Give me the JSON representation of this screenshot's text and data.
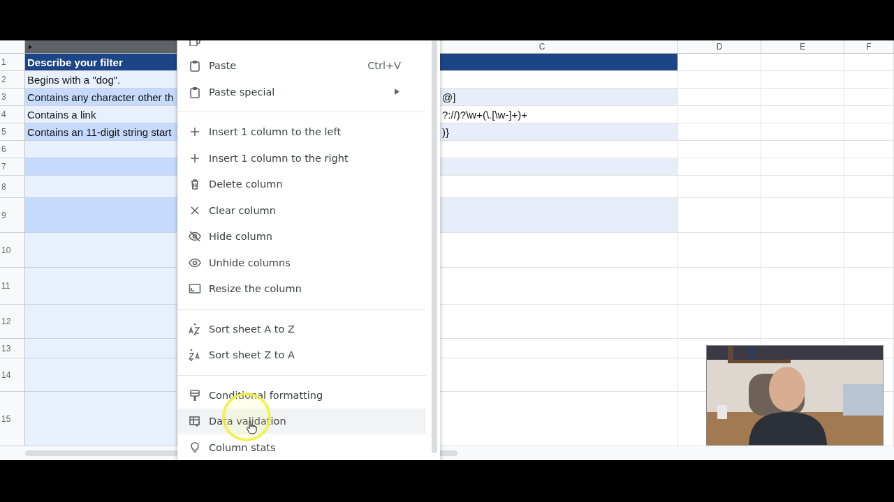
{
  "column_headers": [
    {
      "selected": true
    },
    {
      "label": "C",
      "selected": false
    },
    {
      "label": "D",
      "selected": false
    },
    {
      "label": "E",
      "selected": false
    },
    {
      "label": "F",
      "selected": false
    }
  ],
  "rows": [
    {
      "number": "1",
      "kind": "header",
      "col_a": "Describe your filter"
    },
    {
      "number": "2",
      "kind": "data",
      "banded": false,
      "col_a": "Begins with a \"dog\"."
    },
    {
      "number": "3",
      "kind": "data",
      "banded": true,
      "col_a": "Contains any character other th",
      "col_c": "@]"
    },
    {
      "number": "4",
      "kind": "data",
      "banded": false,
      "col_a": "Contains a link",
      "col_c": "?://)?\\w+(\\.[\\w-]+)+"
    },
    {
      "number": "5",
      "kind": "data",
      "banded": true,
      "col_a": "Contains an 11-digit string start",
      "col_c": ")}"
    },
    {
      "number": "6",
      "kind": "data",
      "banded": false
    },
    {
      "number": "7",
      "kind": "data",
      "banded": true
    },
    {
      "number": "8",
      "kind": "data",
      "banded": false
    },
    {
      "number": "9",
      "kind": "data",
      "banded": true
    },
    {
      "number": "10",
      "kind": "data",
      "banded": false
    },
    {
      "number": "11",
      "kind": "data",
      "banded": false
    },
    {
      "number": "12",
      "kind": "data",
      "banded": false
    },
    {
      "number": "13",
      "kind": "data",
      "banded": false
    },
    {
      "number": "14",
      "kind": "data",
      "banded": false
    },
    {
      "number": "15",
      "kind": "data",
      "banded": false
    }
  ],
  "context_menu": {
    "groups": [
      [
        {
          "kind": "copy",
          "selected": false
        },
        {
          "label": "Paste",
          "shortcut": "Ctrl+V",
          "kind": "paste",
          "submenu": false,
          "selected": false
        },
        {
          "label": "Paste special",
          "kind": "paste",
          "submenu": true,
          "selected": false
        }
      ],
      [
        {
          "label": "Insert 1 column to the left",
          "kind": "plus",
          "selected": false
        },
        {
          "label": "Insert 1 column to the right",
          "kind": "plus",
          "selected": false
        },
        {
          "label": "Delete column",
          "kind": "trash",
          "selected": false
        },
        {
          "label": "Clear column",
          "kind": "close",
          "selected": false
        },
        {
          "label": "Hide column",
          "kind": "eye-off",
          "selected": false
        },
        {
          "label": "Unhide columns",
          "kind": "eye",
          "selected": false
        },
        {
          "label": "Resize the column",
          "kind": "resize",
          "selected": false
        }
      ],
      [
        {
          "label": "Sort sheet A to Z",
          "kind": "sort-az",
          "selected": false
        },
        {
          "label": "Sort sheet Z to A",
          "kind": "sort-za",
          "selected": false
        }
      ],
      [
        {
          "label": "Conditional formatting",
          "kind": "roller",
          "selected": false
        },
        {
          "label": "Data validation",
          "kind": "validation",
          "selected": true
        },
        {
          "label": "Column stats",
          "kind": "bulb",
          "selected": false
        }
      ]
    ]
  }
}
